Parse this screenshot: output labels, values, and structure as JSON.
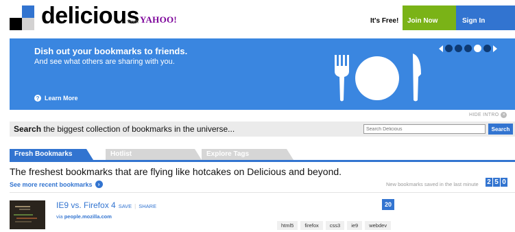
{
  "header": {
    "brand": "delicious",
    "from": "from",
    "yahoo": "YAHOO!",
    "free": "It's Free!",
    "join_label": "Join Now",
    "signin_label": "Sign In"
  },
  "intro": {
    "title": "Dish out your bookmarks to friends.",
    "subtitle": "And see what others are sharing with you.",
    "learn_more": "Learn More",
    "help_glyph": "?",
    "hide_label": "HIDE INTRO",
    "hide_glyph": "×",
    "pager_dots": 5,
    "active_dot": 4
  },
  "search": {
    "bold": "Search",
    "rest": " the biggest collection of bookmarks in the universe...",
    "placeholder": "Search Delicious",
    "button": "Search"
  },
  "tabs": [
    {
      "label": "Fresh Bookmarks",
      "active": true
    },
    {
      "label": "Hotlist",
      "active": false
    },
    {
      "label": "Explore Tags",
      "active": false
    }
  ],
  "fresh": {
    "tagline": "The freshest bookmarks that are flying like hotcakes on Delicious and beyond.",
    "see_more": "See more recent bookmarks",
    "arrow_glyph": "›",
    "saved_label": "New bookmarks saved in the last minute",
    "counter": [
      "2",
      "5",
      "0"
    ]
  },
  "bookmark": {
    "title": "IE9 vs. Firefox 4",
    "save": "SAVE",
    "sep": "|",
    "share": "SHARE",
    "via_prefix": "via",
    "via_site": "people.mozilla.com",
    "count": "20",
    "tags": [
      "html5",
      "firefox",
      "css3",
      "ie9",
      "webdev"
    ]
  },
  "colors": {
    "brand_blue": "#3274d0",
    "banner_blue": "#3a86e0",
    "join_green": "#7ab317",
    "dot_dark": "#0e3a73"
  },
  "icons": [
    "logo-icon",
    "help-icon",
    "plate-icon",
    "close-icon",
    "arrow-right-icon"
  ]
}
